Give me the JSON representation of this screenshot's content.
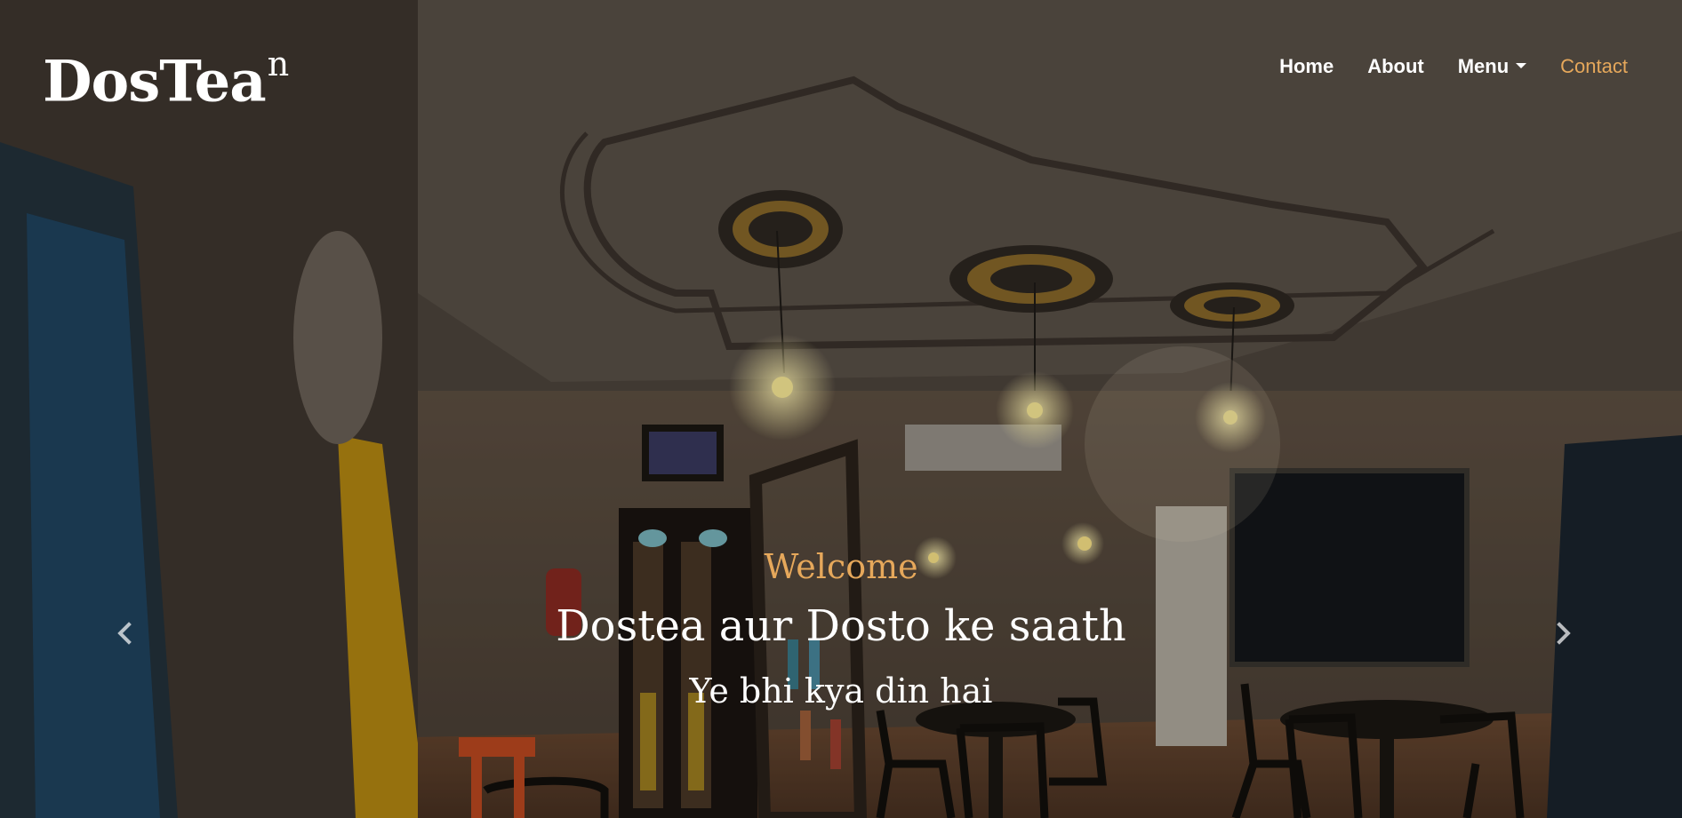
{
  "brand": {
    "name": "DosTea",
    "superscript": "n"
  },
  "nav": {
    "items": [
      {
        "label": "Home"
      },
      {
        "label": "About"
      },
      {
        "label": "Menu"
      },
      {
        "label": "Contact"
      }
    ]
  },
  "hero": {
    "welcome": "Welcome",
    "title": "Dostea aur Dosto ke saath",
    "subtitle": "Ye bhi kya din hai"
  },
  "colors": {
    "accent": "#e6a85b",
    "text": "#ffffff"
  },
  "icons": {
    "prev": "chevron-left-icon",
    "next": "chevron-right-icon"
  }
}
